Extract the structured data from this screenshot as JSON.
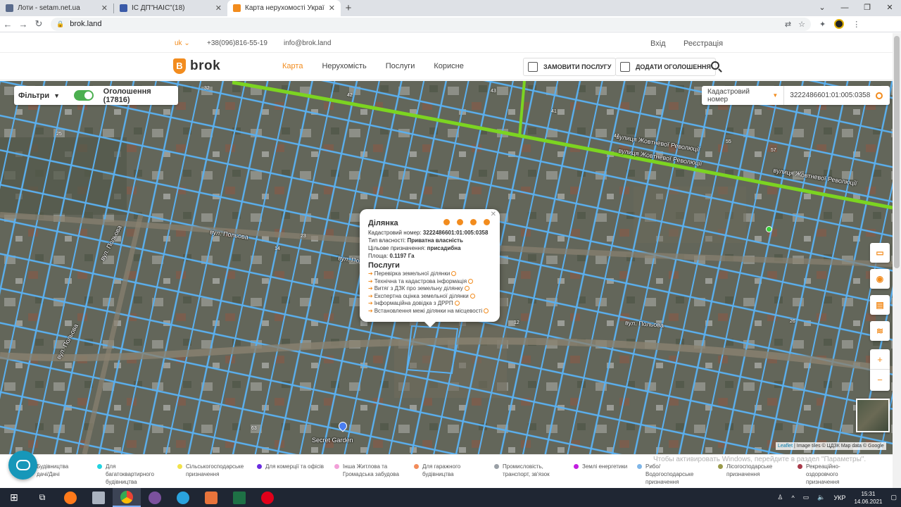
{
  "browser": {
    "tabs": [
      {
        "title": "Лоти - setam.net.ua",
        "active": false,
        "fav_color": "#5a6b8c"
      },
      {
        "title": "ІС ДП\"НАІС\"(18)",
        "active": false,
        "fav_color": "#3a5aa8"
      },
      {
        "title": "Карта нерухомості України | Brok",
        "active": true,
        "fav_color": "#f28c1e"
      }
    ],
    "new_tab": "+",
    "url": "brok.land"
  },
  "topbar": {
    "lang": "uk ⌄",
    "phone": "+38(096)816-55-19",
    "email": "info@brok.land",
    "login": "Вхід",
    "register": "Реєстрація"
  },
  "header": {
    "logo_letter": "B",
    "logo_text": "brok",
    "nav": [
      "Карта",
      "Нерухомість",
      "Послуги",
      "Корисне"
    ],
    "order_service": "ЗАМОВИТИ ПОСЛУГУ",
    "add_listing": "ДОДАТИ ОГОЛОШЕННЯ"
  },
  "map_controls": {
    "filters_label": "Фільтри",
    "listings_label": "Оголошення (17816)",
    "search_type": "Кадастровий номер",
    "search_value": "3222486601:01:005:0358"
  },
  "streets": [
    "вулиця Жовтневої Революції",
    "вулиця Жовтневої Революції",
    "вулиця Жовтневої Революції",
    "вул. Польова",
    "вул. Польова",
    "вул. Польова",
    "вул. Польова",
    "вул. Польова",
    "Secret Garden"
  ],
  "house_numbers": [
    "32",
    "42",
    "43",
    "41",
    "47",
    "55",
    "57",
    "14",
    "23",
    "25",
    "26",
    "12",
    "63"
  ],
  "popup": {
    "title": "Ділянка",
    "cadastral_label": "Кадастровий номер:",
    "cadastral_value": "3222486601:01:005:0358",
    "ownership_label": "Тип власності:",
    "ownership_value": "Приватна власність",
    "purpose_label": "Цільове призначення:",
    "purpose_value": "присадибна",
    "area_label": "Площа:",
    "area_value": "0.1197 Га",
    "services_title": "Послуги",
    "services": [
      "Перевірка земельної ділянки",
      "Технічна та кадастрова інформація",
      "Витяг з ДЗК про земельну ділянку",
      "Експертна оцінка земельної ділянки",
      "Інформаційна довідка з ДРРП",
      "Встановлення межі ділянки на місцевості"
    ]
  },
  "attribution": {
    "leaflet": "Leaflet",
    "rest": "| Image tiles © ЦДЗК  Map data © Google"
  },
  "watermark": "Чтобы активировать Windows, перейдите в раздел \"Параметры\".",
  "legend": [
    {
      "label": "Будівництва\nдачі/Дачі",
      "color": "#2e8b57"
    },
    {
      "label": "Для\nбагатоквартирного\nбудівництва",
      "color": "#22d3e0"
    },
    {
      "label": "Сільськогосподарське\nпризначення",
      "color": "#f2e24a"
    },
    {
      "label": "Для комерції та офісів",
      "color": "#6a2ce0"
    },
    {
      "label": "Інша Житлова та\nГромадська забудова",
      "color": "#f2a0d8"
    },
    {
      "label": "Для гаражного\nбудівництва",
      "color": "#f28c5a"
    },
    {
      "label": "Промисловість,\nтранспорт, зв'язок",
      "color": "#9aa0a6"
    },
    {
      "label": "Землі енергетики",
      "color": "#c21ee0"
    },
    {
      "label": "Рибо/\nВодогосподарське\nпризначення",
      "color": "#7fb6e8"
    },
    {
      "label": "Лісогосподарське\nпризначення",
      "color": "#9a9a4a"
    },
    {
      "label": "Рекреаційно-\nоздоровчого\nпризначення",
      "color": "#a83a4a"
    }
  ],
  "taskbar": {
    "lang": "УКР",
    "time": "15:31",
    "date": "14.06.2021"
  }
}
